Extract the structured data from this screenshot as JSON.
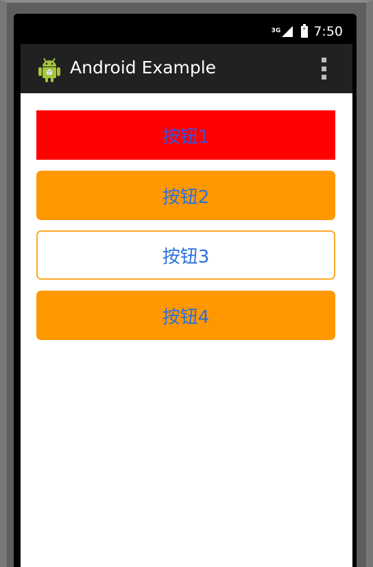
{
  "status_bar": {
    "network": "3G",
    "time": "7:50"
  },
  "action_bar": {
    "title": "Android Example",
    "app_icon": "android-robot-icon",
    "menu_icon": "overflow-menu-icon"
  },
  "buttons": [
    {
      "label": "按钮1",
      "bg": "#ff0000",
      "style": "square-filled"
    },
    {
      "label": "按钮2",
      "bg": "#ff9800",
      "style": "rounded-filled"
    },
    {
      "label": "按钮3",
      "bg": "#ffffff",
      "border": "#ffa726",
      "style": "rounded-outline"
    },
    {
      "label": "按钮4",
      "bg": "#ff9800",
      "style": "rounded-filled"
    }
  ],
  "colors": {
    "label_text": "#2b6fdc",
    "action_bar": "#212121",
    "status_bar": "#000000"
  }
}
